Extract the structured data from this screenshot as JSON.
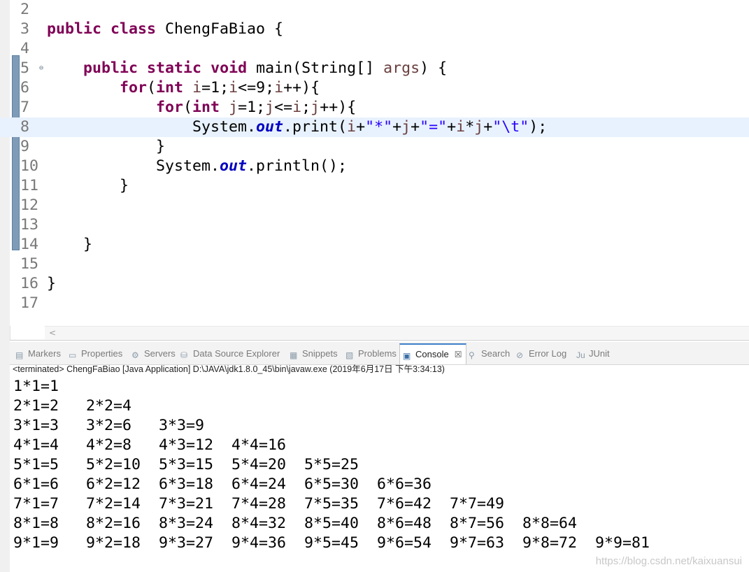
{
  "editor": {
    "lines": [
      {
        "num": "2",
        "html": ""
      },
      {
        "num": "3",
        "html": "<span class=\"kw\">public</span> <span class=\"kw\">class</span> ChengFaBiao {"
      },
      {
        "num": "4",
        "html": ""
      },
      {
        "num": "5",
        "html": "    <span class=\"kw\">public</span> <span class=\"kw\">static</span> <span class=\"kw\">void</span> main(String[] <span class=\"arg\">args</span>) {"
      },
      {
        "num": "6",
        "html": "        <span class=\"kw\">for</span>(<span class=\"kw\">int</span> <span class=\"var\">i</span>=1;<span class=\"var\">i</span>&lt;=9;<span class=\"var\">i</span>++){"
      },
      {
        "num": "7",
        "html": "            <span class=\"kw\">for</span>(<span class=\"kw\">int</span> <span class=\"var\">j</span>=1;<span class=\"var\">j</span>&lt;=<span class=\"var\">i</span>;<span class=\"var\">j</span>++){"
      },
      {
        "num": "8",
        "html": "                System.<span class=\"fld\">out</span>.print(<span class=\"var\">i</span>+<span class=\"str\">\"*\"</span>+<span class=\"var\">j</span>+<span class=\"str\">\"=\"</span>+<span class=\"var\">i</span>*<span class=\"var\">j</span>+<span class=\"str\">\"\\t\"</span>);"
      },
      {
        "num": "9",
        "html": "            }"
      },
      {
        "num": "10",
        "html": "            System.<span class=\"fld\">out</span>.println();"
      },
      {
        "num": "11",
        "html": "        }"
      },
      {
        "num": "12",
        "html": ""
      },
      {
        "num": "13",
        "html": ""
      },
      {
        "num": "14",
        "html": "    }"
      },
      {
        "num": "15",
        "html": ""
      },
      {
        "num": "16",
        "html": "}"
      },
      {
        "num": "17",
        "html": ""
      }
    ],
    "current_line_index": 6,
    "fold_marker": "⊖",
    "scroll_left_arrow": "<"
  },
  "panel": {
    "tabs": [
      {
        "label": "Markers",
        "icon": "markers-icon",
        "active": false
      },
      {
        "label": "Properties",
        "icon": "properties-icon",
        "active": false
      },
      {
        "label": "Servers",
        "icon": "servers-icon",
        "active": false
      },
      {
        "label": "Data Source Explorer",
        "icon": "data-source-icon",
        "active": false
      },
      {
        "label": "Snippets",
        "icon": "snippets-icon",
        "active": false
      },
      {
        "label": "Problems",
        "icon": "problems-icon",
        "active": false
      },
      {
        "label": "Console",
        "icon": "console-icon",
        "active": true
      },
      {
        "label": "Search",
        "icon": "search-icon",
        "active": false
      },
      {
        "label": "Error Log",
        "icon": "error-log-icon",
        "active": false
      },
      {
        "label": "JUnit",
        "icon": "junit-icon",
        "active": false
      }
    ],
    "close_glyph": "☒",
    "status": "<terminated> ChengFaBiao [Java Application] D:\\JAVA\\jdk1.8.0_45\\bin\\javaw.exe (2019年6月17日 下午3:34:13)",
    "output": [
      [
        "1*1=1"
      ],
      [
        "2*1=2",
        "2*2=4"
      ],
      [
        "3*1=3",
        "3*2=6",
        "3*3=9"
      ],
      [
        "4*1=4",
        "4*2=8",
        "4*3=12",
        "4*4=16"
      ],
      [
        "5*1=5",
        "5*2=10",
        "5*3=15",
        "5*4=20",
        "5*5=25"
      ],
      [
        "6*1=6",
        "6*2=12",
        "6*3=18",
        "6*4=24",
        "6*5=30",
        "6*6=36"
      ],
      [
        "7*1=7",
        "7*2=14",
        "7*3=21",
        "7*4=28",
        "7*5=35",
        "7*6=42",
        "7*7=49"
      ],
      [
        "8*1=8",
        "8*2=16",
        "8*3=24",
        "8*4=32",
        "8*5=40",
        "8*6=48",
        "8*7=56",
        "8*8=64"
      ],
      [
        "9*1=9",
        "9*2=18",
        "9*3=27",
        "9*4=36",
        "9*5=45",
        "9*6=54",
        "9*7=63",
        "9*8=72",
        "9*9=81"
      ]
    ],
    "watermark": "https://blog.csdn.net/kaixuansui"
  },
  "colors": {
    "keyword": "#7f0055",
    "string": "#2a00ff",
    "field": "#0000c0",
    "current_line": "#e8f2fe",
    "active_tab_accent": "#3c7fc9"
  }
}
